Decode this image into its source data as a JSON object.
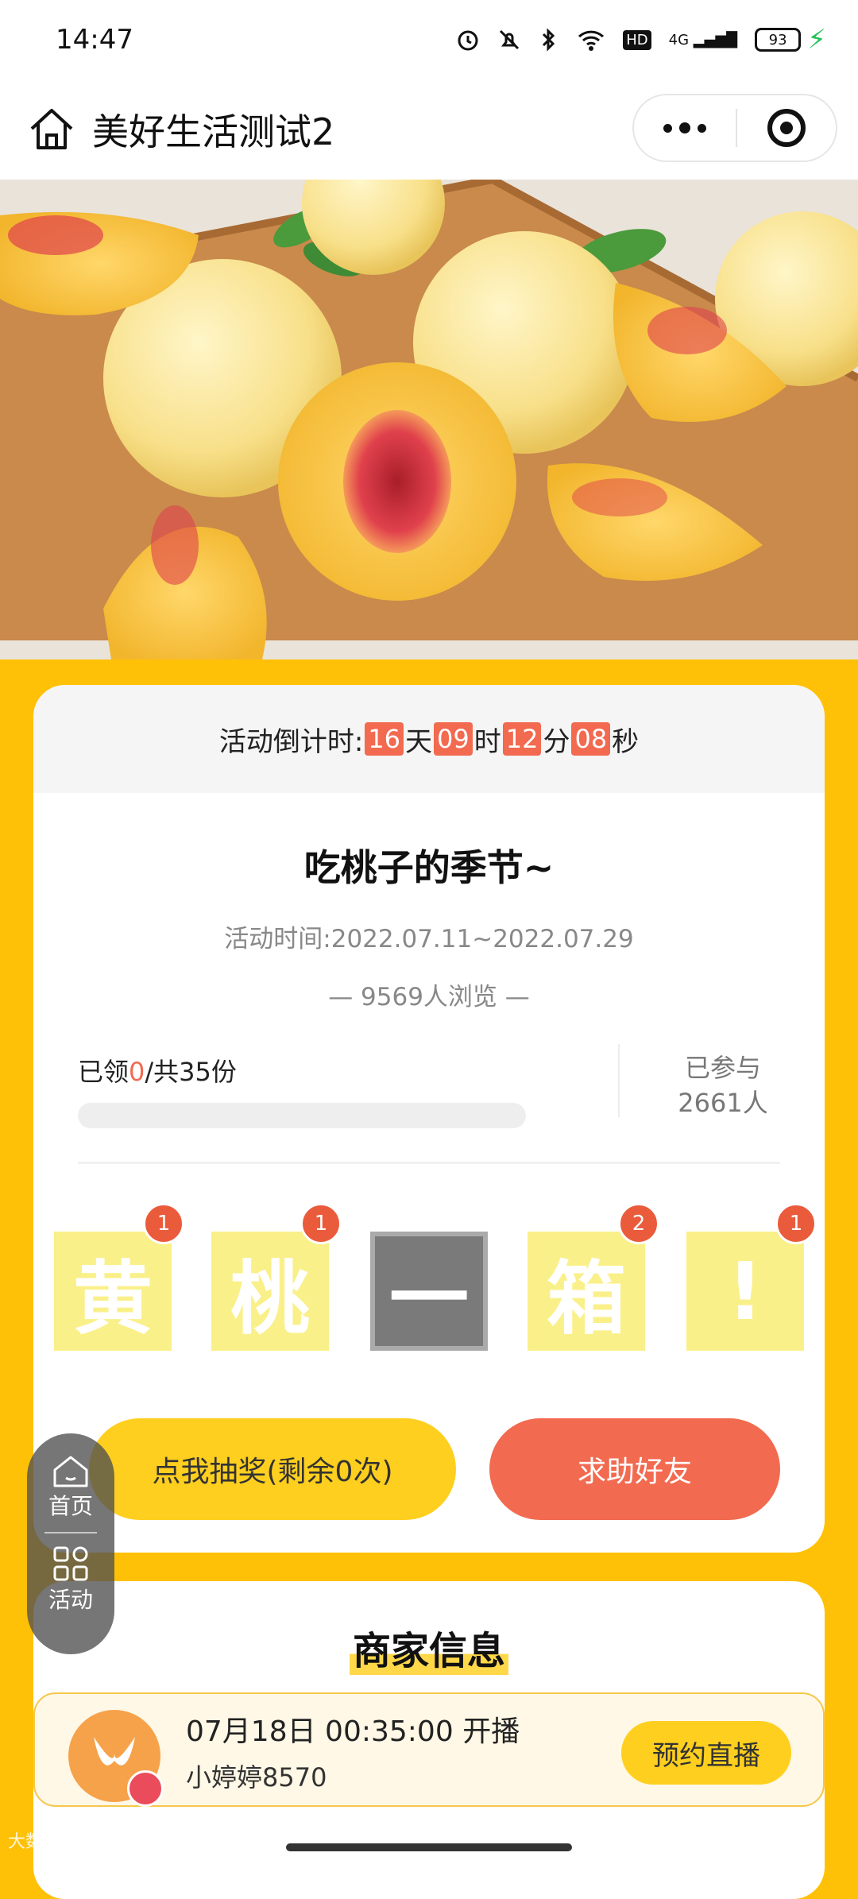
{
  "status": {
    "time": "14:47",
    "battery": "93",
    "net_label": "4G",
    "hd_label": "HD"
  },
  "nav": {
    "title": "美好生活测试2"
  },
  "countdown": {
    "label": "活动倒计时:",
    "days": "16",
    "day_unit": "天",
    "hours": "09",
    "hour_unit": "时",
    "minutes": "12",
    "minute_unit": "分",
    "seconds": "08",
    "second_unit": "秒"
  },
  "activity": {
    "title": "吃桃子的季节~",
    "time": "活动时间:2022.07.11~2022.07.29",
    "views": "— 9569人浏览 —",
    "claimed_prefix": "已领",
    "claimed_count": "0",
    "claimed_suffix": "/共35份",
    "progress": 0,
    "joined_label": "已参与",
    "joined_count": "2661人"
  },
  "letters": [
    {
      "char": "黄",
      "count": "1"
    },
    {
      "char": "桃",
      "count": "1"
    },
    {
      "char": "一",
      "count": ""
    },
    {
      "char": "箱",
      "count": "2"
    },
    {
      "char": "!",
      "count": "1"
    }
  ],
  "buttons": {
    "draw": "点我抽奖(剩余0次)",
    "help": "求助好友"
  },
  "merchant": {
    "title": "商家信息"
  },
  "sidenav": {
    "home": "首页",
    "activity": "活动"
  },
  "live": {
    "time": "07月18日 00:35:00 开播",
    "user": "小婷婷8570",
    "button": "预约直播"
  },
  "watermark": "大数据"
}
